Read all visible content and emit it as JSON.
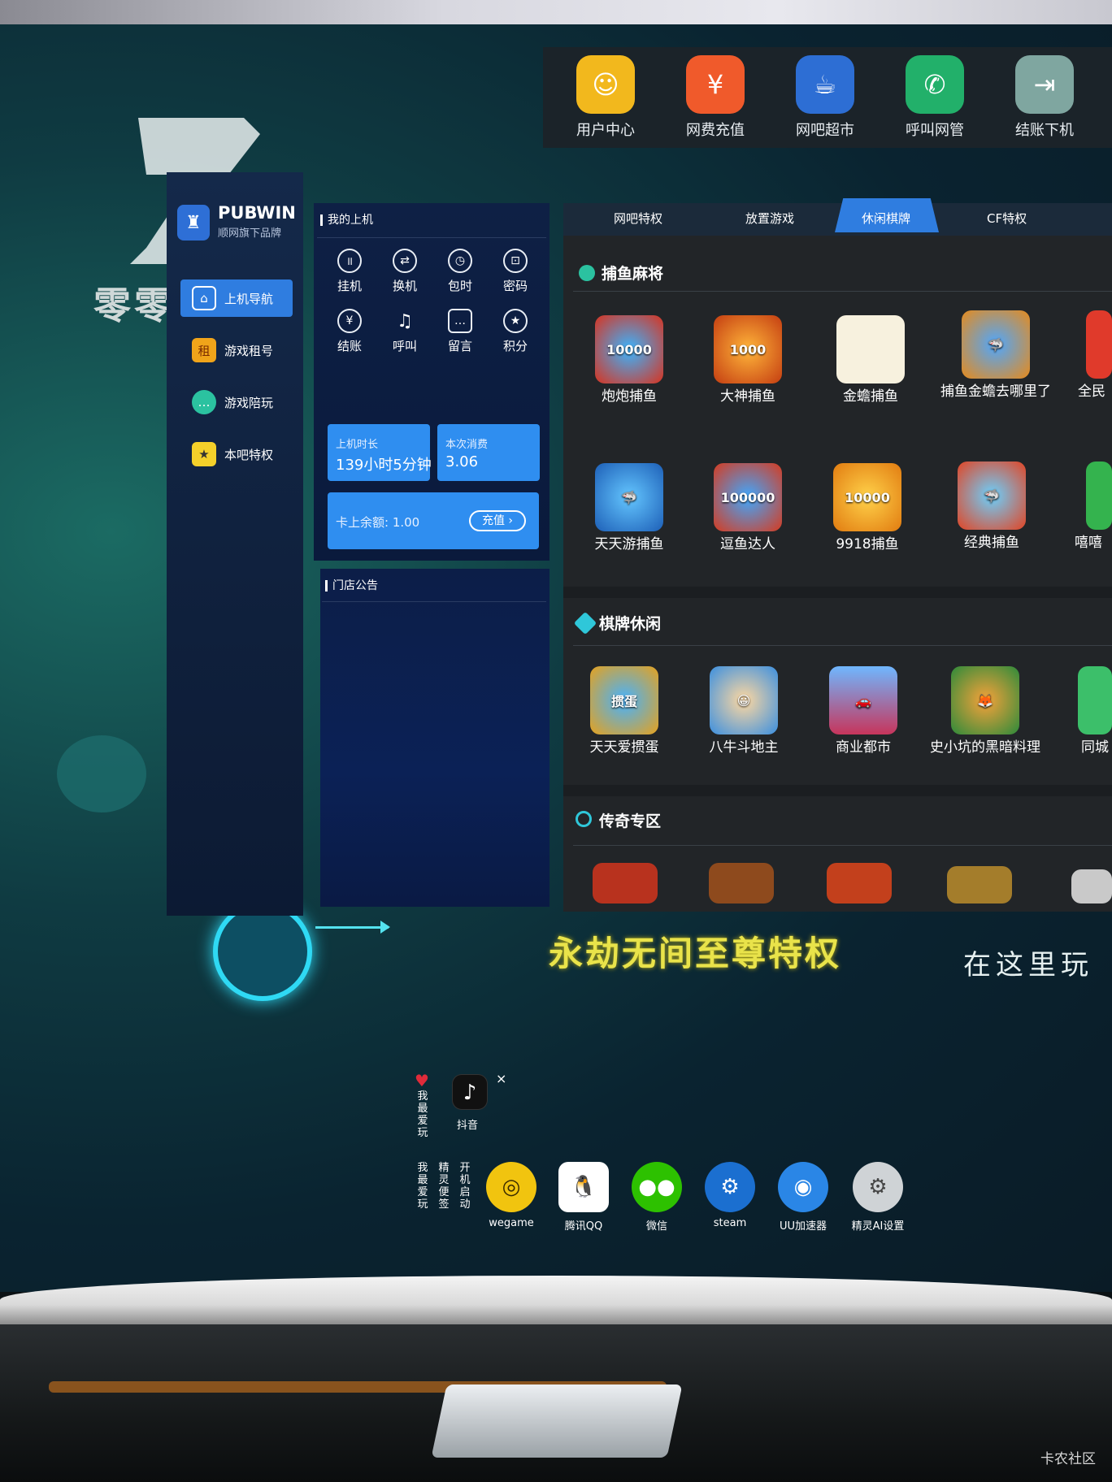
{
  "topbar": {
    "items": [
      {
        "label": "用户中心",
        "icon": "user-center-icon",
        "color": "#f2b81d"
      },
      {
        "label": "网费充值",
        "icon": "recharge-icon",
        "color": "#f05a2b"
      },
      {
        "label": "网吧超市",
        "icon": "supermarket-icon",
        "color": "#2d6ed4"
      },
      {
        "label": "呼叫网管",
        "icon": "phone-icon",
        "color": "#22b06a"
      },
      {
        "label": "结账下机",
        "icon": "checkout-icon",
        "color": "#7fa6a0"
      }
    ]
  },
  "brand": {
    "name": "PUBWIN",
    "sub": "顺网旗下品牌"
  },
  "sidebar": {
    "items": [
      {
        "label": "上机导航",
        "active": true
      },
      {
        "label": "游戏租号",
        "active": false
      },
      {
        "label": "游戏陪玩",
        "active": false
      },
      {
        "label": "本吧特权",
        "active": false
      }
    ]
  },
  "session": {
    "title": "我的上机",
    "actions": [
      "挂机",
      "换机",
      "包时",
      "密码",
      "结账",
      "呼叫",
      "留言",
      "积分"
    ],
    "duration_label": "上机时长",
    "duration_value": "139小时5分钟",
    "cost_label": "本次消费",
    "cost_value": "3.06",
    "balance_label": "卡上余额: 1.00",
    "recharge_label": "充值 ›"
  },
  "notice": {
    "title": "门店公告"
  },
  "tabs": [
    "网吧特权",
    "放置游戏",
    "休闲棋牌",
    "CF特权"
  ],
  "categories": [
    {
      "title": "捕鱼麻将",
      "games": [
        "炮炮捕鱼",
        "大神捕鱼",
        "金蟾捕鱼",
        "捕鱼金蟾去哪里了",
        "全民",
        "天天游捕鱼",
        "逗鱼达人",
        "9918捕鱼",
        "经典捕鱼",
        "嘻嘻"
      ]
    },
    {
      "title": "棋牌休闲",
      "games": [
        "天天爱掼蛋",
        "八牛斗地主",
        "商业都市",
        "史小坑的黑暗料理",
        "同城"
      ]
    },
    {
      "title": "传奇专区",
      "games": []
    }
  ],
  "background": {
    "logo_text": "零零",
    "slogan": "永劫无间至尊特权",
    "right_text": "在这里玩"
  },
  "dock": {
    "float_label": "抖音",
    "fav_label": "我最爱玩",
    "items": [
      "wegame",
      "腾讯QQ",
      "微信",
      "steam",
      "UU加速器",
      "精灵AI设置"
    ],
    "vertical": [
      "我最爱玩",
      "精灵便签",
      "开机启动"
    ]
  },
  "watermark": "卡农社区"
}
